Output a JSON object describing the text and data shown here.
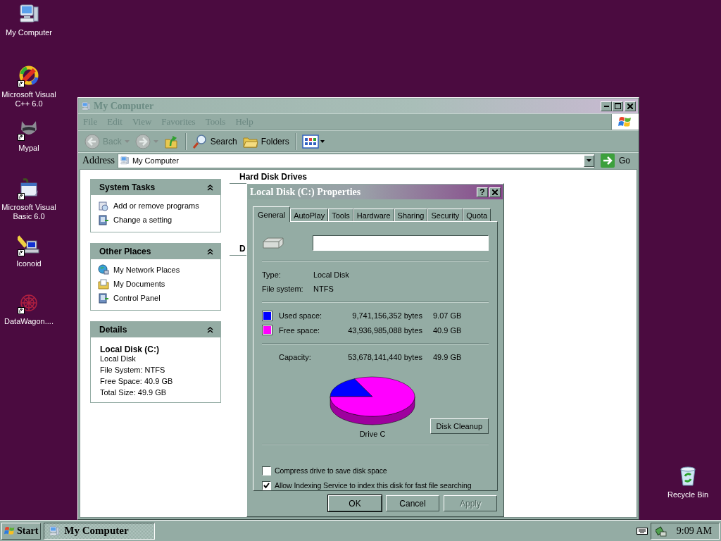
{
  "desktop_icons": [
    {
      "label": "My Computer",
      "kind": "computer",
      "shortcut": false
    },
    {
      "label": "Microsoft Visual C++ 6.0",
      "kind": "blocks",
      "shortcut": true
    },
    {
      "label": "Mypal",
      "kind": "animal",
      "shortcut": true
    },
    {
      "label": "Microsoft Visual Basic 6.0",
      "kind": "window",
      "shortcut": true
    },
    {
      "label": "Iconoid",
      "kind": "pencil",
      "shortcut": true
    },
    {
      "label": "DataWagon....",
      "kind": "flower",
      "shortcut": true
    },
    {
      "label": "Recycle Bin",
      "kind": "bin",
      "shortcut": false
    }
  ],
  "explorer": {
    "title": "My Computer",
    "active": false,
    "menu": [
      "File",
      "Edit",
      "View",
      "Favorites",
      "Tools",
      "Help"
    ],
    "toolbar": [
      {
        "kind": "back",
        "label": "Back",
        "disabled": true
      },
      {
        "kind": "forward",
        "disabled": true
      },
      {
        "kind": "up",
        "disabled": false
      },
      {
        "kind": "search",
        "label": "Search",
        "disabled": false
      },
      {
        "kind": "folders",
        "label": "Folders",
        "disabled": false
      },
      {
        "kind": "views",
        "disabled": false
      }
    ],
    "address": {
      "label": "Address",
      "value": "My Computer",
      "go": "Go"
    },
    "task_panes": [
      {
        "title": "System Tasks",
        "items": [
          {
            "label": "Add or remove programs",
            "kind": "programs"
          },
          {
            "label": "Change a setting",
            "kind": "setting"
          }
        ]
      },
      {
        "title": "Other Places",
        "items": [
          {
            "label": "My Network Places",
            "kind": "network"
          },
          {
            "label": "My Documents",
            "kind": "documents"
          },
          {
            "label": "Control Panel",
            "kind": "setting"
          }
        ]
      },
      {
        "title": "Details",
        "details": {
          "name": "Local Disk (C:)",
          "lines": [
            "Local Disk",
            "File System: NTFS",
            "Free Space: 40.9 GB",
            "Total Size: 49.9 GB"
          ]
        }
      }
    ],
    "section_headings": [
      "Hard Disk Drives",
      "D"
    ]
  },
  "dialog": {
    "title": "Local Disk (C:) Properties",
    "help": "?",
    "active": true,
    "tabs": [
      {
        "label": "General",
        "selected": true
      },
      {
        "label": "AutoPlay",
        "selected": false
      },
      {
        "label": "Tools",
        "selected": false
      },
      {
        "label": "Hardware",
        "selected": false
      },
      {
        "label": "Sharing",
        "selected": false
      },
      {
        "label": "Security",
        "selected": false
      },
      {
        "label": "Quota",
        "selected": false
      }
    ],
    "properties": [
      {
        "label": "Type:",
        "value": "Local Disk"
      },
      {
        "label": "File system:",
        "value": "NTFS"
      }
    ],
    "space": [
      {
        "label": "Used space:",
        "bytes": "9,741,156,352 bytes",
        "size": "9.07 GB",
        "color": "#0000ff"
      },
      {
        "label": "Free space:",
        "bytes": "43,936,985,088 bytes",
        "size": "40.9 GB",
        "color": "#ff00ff"
      }
    ],
    "capacity": {
      "label": "Capacity:",
      "bytes": "53,678,141,440 bytes",
      "size": "49.9 GB"
    },
    "drive_label": "Drive C",
    "cleanup_button": "Disk Cleanup",
    "checkboxes": [
      {
        "label": "Compress drive to save disk space",
        "checked": false
      },
      {
        "label": "Allow Indexing Service to index this disk for fast file searching",
        "checked": true
      }
    ],
    "buttons": [
      {
        "label": "OK",
        "default": true,
        "disabled": false
      },
      {
        "label": "Cancel",
        "default": false,
        "disabled": false
      },
      {
        "label": "Apply",
        "default": false,
        "disabled": true
      }
    ]
  },
  "taskbar": {
    "start": "Start",
    "tasks": [
      {
        "label": "My Computer",
        "selected": true
      }
    ],
    "clock": "9:09 AM"
  }
}
